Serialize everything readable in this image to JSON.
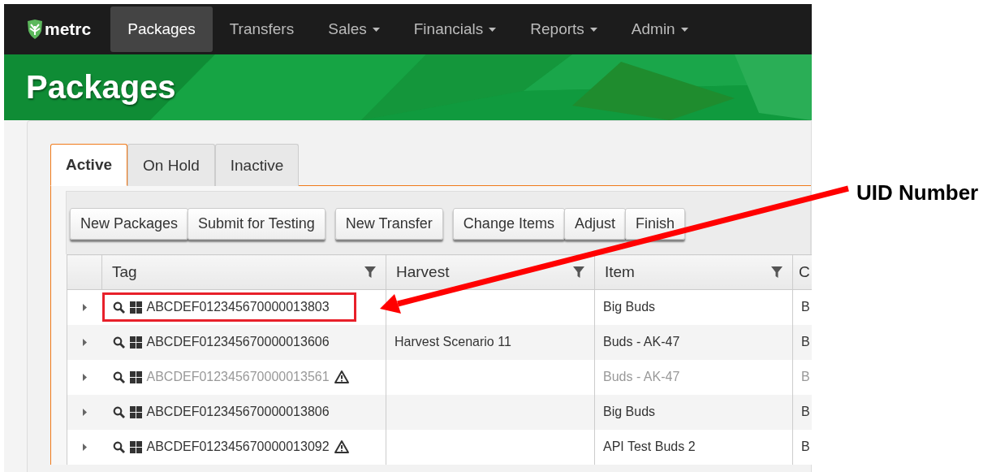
{
  "nav": {
    "logo": "metrc",
    "items": [
      {
        "label": "Packages",
        "selected": true,
        "dropdown": false
      },
      {
        "label": "Transfers",
        "selected": false,
        "dropdown": false
      },
      {
        "label": "Sales",
        "selected": false,
        "dropdown": true
      },
      {
        "label": "Financials",
        "selected": false,
        "dropdown": true
      },
      {
        "label": "Reports",
        "selected": false,
        "dropdown": true
      },
      {
        "label": "Admin",
        "selected": false,
        "dropdown": true
      }
    ]
  },
  "page_title": "Packages",
  "tabs": [
    {
      "label": "Active",
      "selected": true
    },
    {
      "label": "On Hold",
      "selected": false
    },
    {
      "label": "Inactive",
      "selected": false
    }
  ],
  "toolbar": [
    {
      "buttons": [
        "New Packages",
        "Submit for Testing"
      ]
    },
    {
      "buttons": [
        "New Transfer"
      ]
    },
    {
      "buttons": [
        "Change Items",
        "Adjust",
        "Finish"
      ]
    }
  ],
  "table": {
    "columns": [
      {
        "label": "Tag",
        "filter": true
      },
      {
        "label": "Harvest",
        "filter": true
      },
      {
        "label": "Item",
        "filter": true
      },
      {
        "label": "C",
        "filter": false
      }
    ],
    "rows": [
      {
        "tag": "ABCDEF012345670000013803",
        "warning": false,
        "disabled": false,
        "highlighted": true,
        "harvest": "",
        "item": "Big Buds",
        "column_4": "B"
      },
      {
        "tag": "ABCDEF012345670000013606",
        "warning": false,
        "disabled": false,
        "highlighted": false,
        "harvest": "Harvest Scenario 11",
        "item": "Buds - AK-47",
        "column_4": "B"
      },
      {
        "tag": "ABCDEF012345670000013561",
        "warning": true,
        "disabled": true,
        "highlighted": false,
        "harvest": "",
        "item": "Buds - AK-47",
        "column_4": "B"
      },
      {
        "tag": "ABCDEF012345670000013806",
        "warning": false,
        "disabled": false,
        "highlighted": false,
        "harvest": "",
        "item": "Big Buds",
        "column_4": "B"
      },
      {
        "tag": "ABCDEF012345670000013092",
        "warning": true,
        "disabled": false,
        "highlighted": false,
        "harvest": "",
        "item": "API Test Buds 2",
        "column_4": "B"
      }
    ]
  },
  "annotation": {
    "label": "UID Number"
  }
}
